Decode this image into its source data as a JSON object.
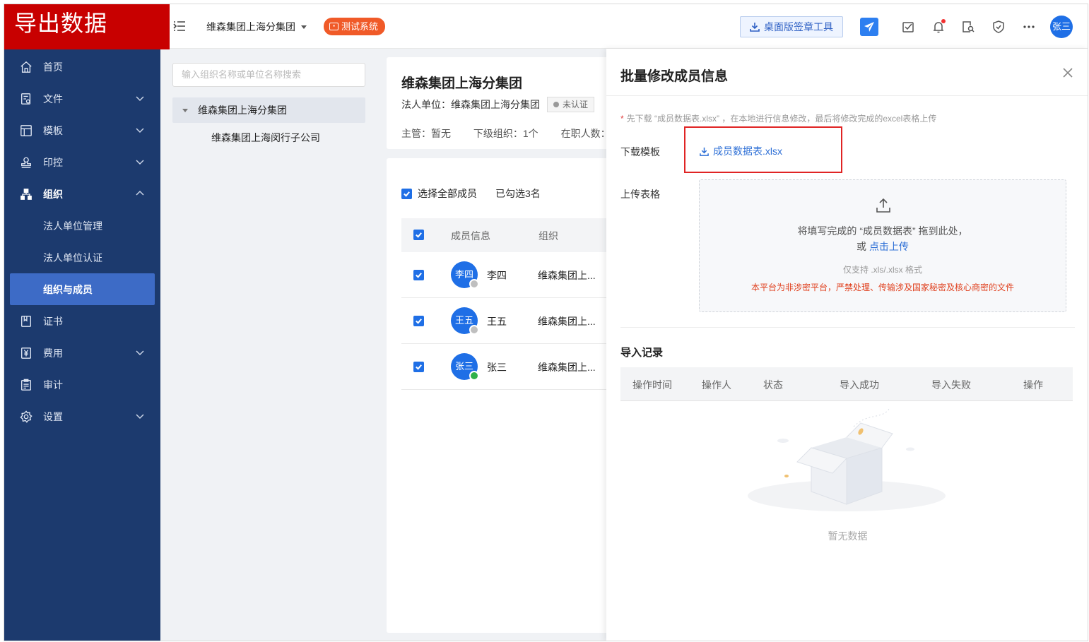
{
  "banner": "导出数据",
  "sidebar": {
    "items": [
      {
        "label": "首页"
      },
      {
        "label": "文件"
      },
      {
        "label": "模板"
      },
      {
        "label": "印控"
      },
      {
        "label": "组织"
      },
      {
        "label": "法人单位管理"
      },
      {
        "label": "法人单位认证"
      },
      {
        "label": "组织与成员"
      },
      {
        "label": "证书"
      },
      {
        "label": "费用"
      },
      {
        "label": "审计"
      },
      {
        "label": "设置"
      }
    ]
  },
  "header": {
    "org_name": "维森集团上海分集团",
    "badge": "测试系统",
    "tool_button": "桌面版签章工具",
    "avatar": "张三"
  },
  "tree": {
    "search_placeholder": "输入组织名称或单位名称搜索",
    "root": "维森集团上海分集团",
    "child": "维森集团上海闵行子公司"
  },
  "org_card": {
    "title": "维森集团上海分集团",
    "legal_unit": "法人单位：维森集团上海分集团",
    "cert_status": "未认证",
    "manager": "主管：暂无",
    "sub_orgs": "下级组织：1个",
    "staff": "在职人数："
  },
  "members": {
    "select_all": "选择全部成员",
    "selected_count": "已勾选3名",
    "col_info": "成员信息",
    "col_org": "组织",
    "rows": [
      {
        "avatar": "李四",
        "name": "李四",
        "org": "维森集团上...",
        "status": "unverified"
      },
      {
        "avatar": "王五",
        "name": "王五",
        "org": "维森集团上...",
        "status": "unverified"
      },
      {
        "avatar": "张三",
        "name": "张三",
        "org": "维森集团上...",
        "status": "verified"
      }
    ]
  },
  "drawer": {
    "title": "批量修改成员信息",
    "hint": "先下载 “成员数据表.xlsx” ，在本地进行信息修改，最后将修改完成的excel表格上传",
    "download_label": "下载模板",
    "download_file": "成员数据表.xlsx",
    "upload_label": "上传表格",
    "upload_text1": "将填写完成的 “成员数据表” 拖到此处，",
    "upload_or": "或 ",
    "upload_link": "点击上传",
    "upload_format": "仅支持 .xls/.xlsx 格式",
    "upload_warning": "本平台为非涉密平台，严禁处理、传输涉及国家秘密及核心商密的文件",
    "records_title": "导入记录",
    "columns": [
      "操作时间",
      "操作人",
      "状态",
      "导入成功",
      "导入失败",
      "操作"
    ],
    "empty_text": "暂无数据"
  },
  "colors": {
    "sidebar_bg": "#1c3a6e",
    "active_item": "#3d6bc6",
    "banner_bg": "#c80000",
    "primary": "#1f6fe6",
    "badge": "#f05a28",
    "warning_text": "#e0401e"
  }
}
